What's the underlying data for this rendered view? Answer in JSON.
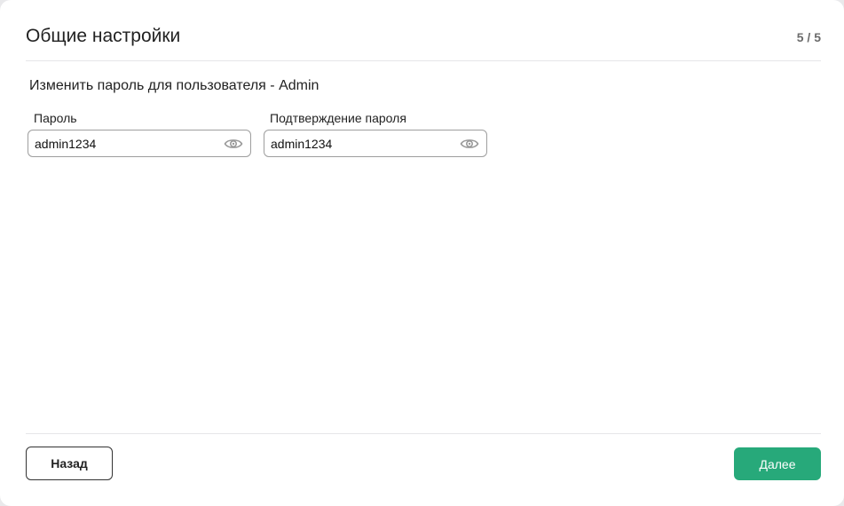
{
  "dialog": {
    "title": "Общие настройки",
    "step": "5 / 5"
  },
  "section": {
    "title": "Изменить пароль для пользователя - Admin"
  },
  "fields": {
    "password": {
      "label": "Пароль",
      "value": "admin1234",
      "icon": "eye-icon"
    },
    "confirm": {
      "label": "Подтверждение пароля",
      "value": "admin1234",
      "icon": "eye-icon"
    }
  },
  "buttons": {
    "back": "Назад",
    "next": "Далее"
  },
  "colors": {
    "accent": "#27a97a",
    "border": "#9e9e9e"
  }
}
